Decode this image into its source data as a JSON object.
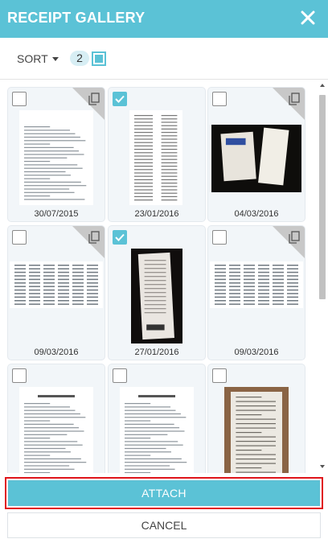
{
  "header": {
    "title": "RECEIPT GALLERY",
    "close_icon": "close-icon"
  },
  "toolbar": {
    "sort_label": "SORT",
    "selected_count": "2"
  },
  "receipts": [
    {
      "date": "30/07/2015",
      "checked": false,
      "has_copy": true,
      "thumb": "document"
    },
    {
      "date": "23/01/2016",
      "checked": true,
      "has_copy": false,
      "thumb": "receipt"
    },
    {
      "date": "04/03/2016",
      "checked": false,
      "has_copy": true,
      "thumb": "photo"
    },
    {
      "date": "09/03/2016",
      "checked": false,
      "has_copy": true,
      "thumb": "table"
    },
    {
      "date": "27/01/2016",
      "checked": true,
      "has_copy": false,
      "thumb": "photo-receipt"
    },
    {
      "date": "09/03/2016",
      "checked": false,
      "has_copy": true,
      "thumb": "table"
    },
    {
      "date": "",
      "checked": false,
      "has_copy": false,
      "thumb": "form"
    },
    {
      "date": "",
      "checked": false,
      "has_copy": false,
      "thumb": "form"
    },
    {
      "date": "",
      "checked": false,
      "has_copy": false,
      "thumb": "photo-paper"
    }
  ],
  "actions": {
    "attach_label": "ATTACH",
    "cancel_label": "CANCEL"
  },
  "colors": {
    "accent": "#5bc2d6",
    "highlight_border": "#e0151b"
  }
}
